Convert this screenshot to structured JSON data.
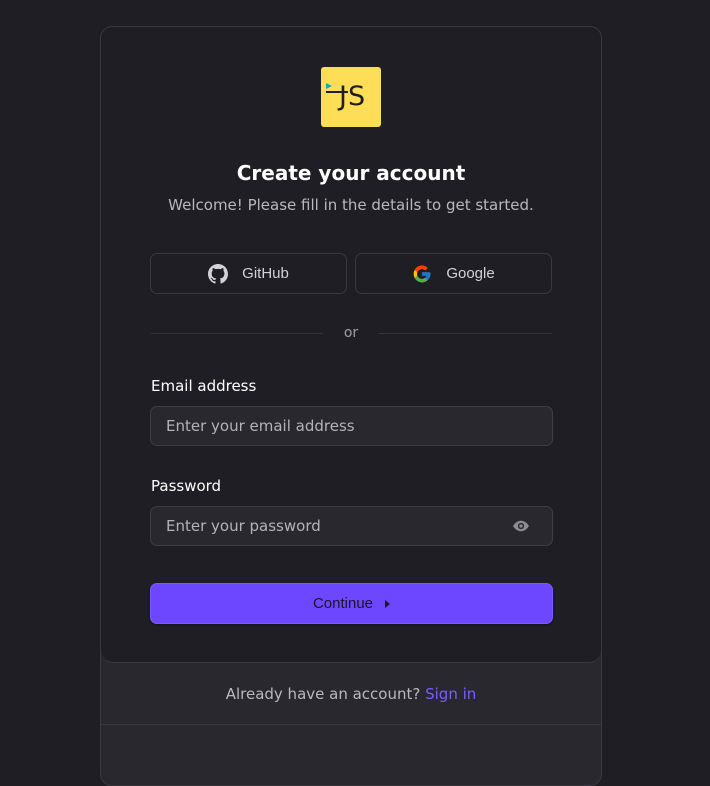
{
  "logo": {
    "text": "JS"
  },
  "header": {
    "title": "Create your account",
    "subtitle": "Welcome! Please fill in the details to get started."
  },
  "social": {
    "github_label": "GitHub",
    "google_label": "Google"
  },
  "divider": {
    "text": "or"
  },
  "form": {
    "email_label": "Email address",
    "email_placeholder": "Enter your email address",
    "email_value": "",
    "password_label": "Password",
    "password_placeholder": "Enter your password",
    "password_value": "",
    "continue_label": "Continue"
  },
  "footer": {
    "prompt": "Already have an account?",
    "link": "Sign in"
  },
  "colors": {
    "background": "#1f1e24",
    "accent": "#6c47ff",
    "link": "#7c5cff",
    "logo_bg": "#fedd57"
  },
  "icons": [
    "github-icon",
    "google-icon",
    "eye-icon",
    "play-icon"
  ]
}
